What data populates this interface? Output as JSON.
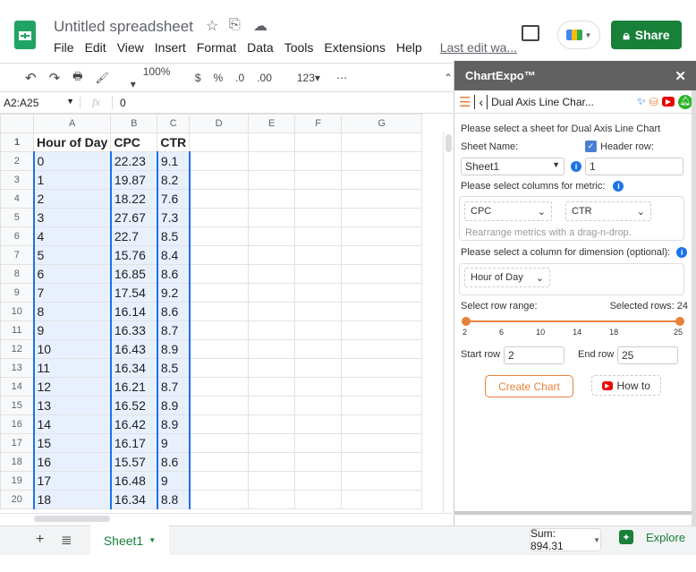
{
  "app": {
    "title": "Untitled spreadsheet",
    "last_edit": "Last edit wa...",
    "share_label": "Share"
  },
  "menu": [
    "File",
    "Edit",
    "View",
    "Insert",
    "Format",
    "Data",
    "Tools",
    "Extensions",
    "Help"
  ],
  "toolbar": {
    "zoom": "100%",
    "currency": "$",
    "percent": "%",
    "dec_decrease": ".0",
    "dec_increase": ".00",
    "format": "123",
    "more": "⋯"
  },
  "formula_bar": {
    "name_box": "A2:A25",
    "fx": "fx",
    "value": "0"
  },
  "columns": [
    "A",
    "B",
    "C",
    "D",
    "E",
    "F",
    "G"
  ],
  "rows": [
    {
      "n": "1",
      "a": "Hour of Day",
      "b": "CPC",
      "c": "CTR"
    },
    {
      "n": "2",
      "a": "0",
      "b": "22.23",
      "c": "9.1"
    },
    {
      "n": "3",
      "a": "1",
      "b": "19.87",
      "c": "8.2"
    },
    {
      "n": "4",
      "a": "2",
      "b": "18.22",
      "c": "7.6"
    },
    {
      "n": "5",
      "a": "3",
      "b": "27.67",
      "c": "7.3"
    },
    {
      "n": "6",
      "a": "4",
      "b": "22.7",
      "c": "8.5"
    },
    {
      "n": "7",
      "a": "5",
      "b": "15.76",
      "c": "8.4"
    },
    {
      "n": "8",
      "a": "6",
      "b": "16.85",
      "c": "8.6"
    },
    {
      "n": "9",
      "a": "7",
      "b": "17.54",
      "c": "9.2"
    },
    {
      "n": "10",
      "a": "8",
      "b": "16.14",
      "c": "8.6"
    },
    {
      "n": "11",
      "a": "9",
      "b": "16.33",
      "c": "8.7"
    },
    {
      "n": "12",
      "a": "10",
      "b": "16.43",
      "c": "8.9"
    },
    {
      "n": "13",
      "a": "11",
      "b": "16.34",
      "c": "8.5"
    },
    {
      "n": "14",
      "a": "12",
      "b": "16.21",
      "c": "8.7"
    },
    {
      "n": "15",
      "a": "13",
      "b": "16.52",
      "c": "8.9"
    },
    {
      "n": "16",
      "a": "14",
      "b": "16.42",
      "c": "8.9"
    },
    {
      "n": "17",
      "a": "15",
      "b": "16.17",
      "c": "9"
    },
    {
      "n": "18",
      "a": "16",
      "b": "15.57",
      "c": "8.6"
    },
    {
      "n": "19",
      "a": "17",
      "b": "16.48",
      "c": "9"
    },
    {
      "n": "20",
      "a": "18",
      "b": "16.34",
      "c": "8.8"
    }
  ],
  "bottom": {
    "sheet_tab": "Sheet1",
    "sum": "Sum: 894.31",
    "explore": "Explore"
  },
  "panel": {
    "title": "ChartExpo™",
    "chart_name": "Dual Axis Line Char...",
    "select_sheet_text": "Please select a sheet for Dual Axis Line Chart",
    "sheet_name_label": "Sheet Name:",
    "header_row_label": "Header row:",
    "header_row_checked": true,
    "sheet_value": "Sheet1",
    "header_row_value": "1",
    "metric_label": "Please select columns for metric:",
    "metric_1": "CPC",
    "metric_2": "CTR",
    "metric_hint": "Rearrange metrics with a drag-n-drop.",
    "dimension_label": "Please select a column for dimension (optional):",
    "dimension_value": "Hour of Day",
    "row_range_label": "Select row range:",
    "selected_rows": "Selected rows: 24",
    "slider_ticks": [
      "2",
      "6",
      "10",
      "14",
      "18",
      "25"
    ],
    "slider_range": {
      "min": 2,
      "max": 25,
      "start": 2,
      "end": 25
    },
    "start_row_label": "Start row",
    "start_row": "2",
    "end_row_label": "End row",
    "end_row": "25",
    "create_chart": "Create Chart",
    "how_to": "How to"
  },
  "colors": {
    "accent": "#e8803a",
    "share": "#188038",
    "selection": "#1a73e8"
  }
}
